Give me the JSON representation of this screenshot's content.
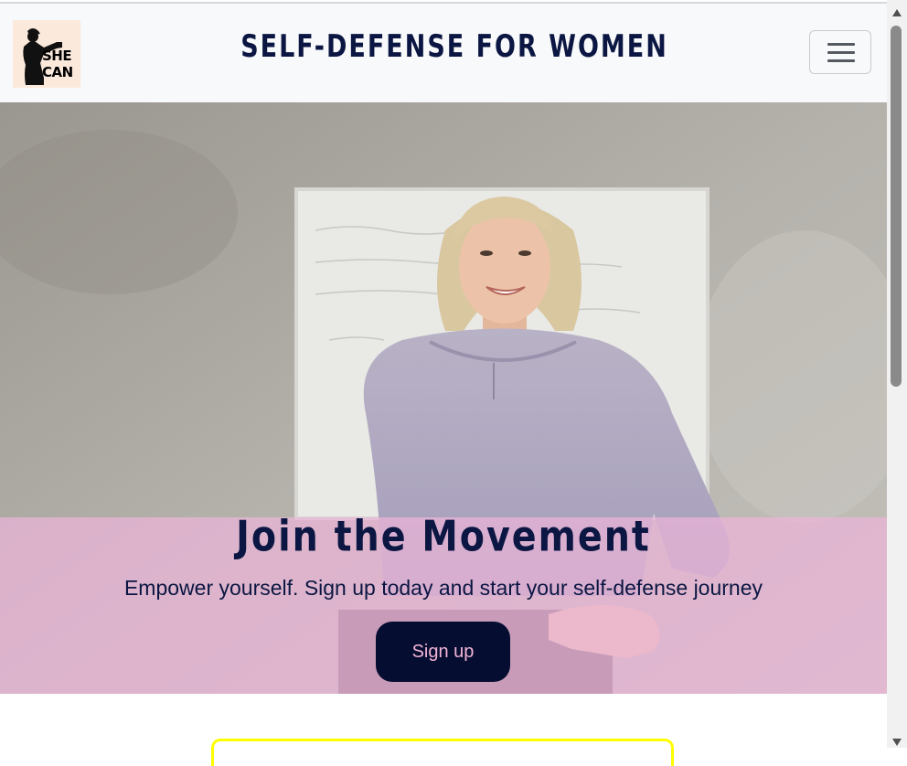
{
  "navbar": {
    "logo_line1": "SHE",
    "logo_line2": "CAN",
    "title": "SELF-DEFENSE FOR WOMEN"
  },
  "hero": {
    "title": "Join the Movement",
    "subtitle": "Empower yourself. Sign up today and start your self-defense journey",
    "button_label": "Sign up",
    "image_description_icon": "woman-photo"
  },
  "colors": {
    "brand_navy": "#0b1642",
    "button_bg": "#050d30",
    "button_text": "#f4b5d8",
    "overlay_pink": "#ecb4d8",
    "card_border": "#ffff00"
  }
}
